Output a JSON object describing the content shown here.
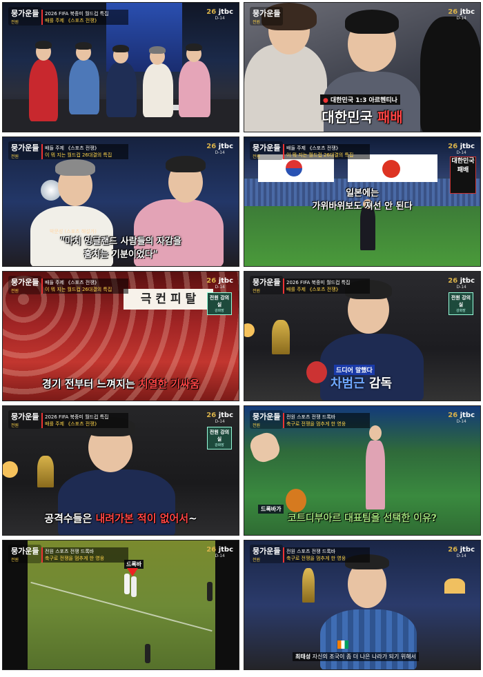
{
  "show": {
    "logo": "뭉가운들",
    "logo_sub": "전원",
    "channel_prefix": "26",
    "channel": "jtbc",
    "dday": "D-14"
  },
  "frames": [
    {
      "id": "f1",
      "topic": "2026 FIFA 북중미 월드컵 특집",
      "topic2": "배를 주제 《스포츠 전쟁》"
    },
    {
      "id": "f2",
      "score": "대한민국 1:3 아르헨티나",
      "caption": "대한민국 패배",
      "caption_red": "패배"
    },
    {
      "id": "f3",
      "topic": "배들 주제 《스포츠 전쟁》",
      "topic2": "이 뭐 지는 월드컵 26대결의 특집",
      "name": "박문성 (스포츠 해설가)",
      "quote_line1": "\"마치 잉글랜드 사람들의 자감을",
      "quote_line2": "훔치는 기분이었다\""
    },
    {
      "id": "f4",
      "topic": "배들 주제 《스포츠 전쟁》",
      "topic2": "이 뭐 지는 월드컵 26대결의 특집",
      "side_card": "대한민국 패배",
      "caption_line1": "일본에는",
      "caption_line2": "가위바위보도 져선 안 된다"
    },
    {
      "id": "f5",
      "topic": "배들 주제 《스포츠 전쟁》",
      "topic2": "이 뭐 지는 월드컵 26대결의 특집",
      "banner": "극 컨 피 탈",
      "badge": "전원 강의실",
      "badge_sub": "강화장",
      "caption_pre": "경기 전부터 느껴지는 ",
      "caption_red": "치열한 기싸움"
    },
    {
      "id": "f6",
      "topic": "2026 FIFA 북중미 월드컵 특집",
      "topic2": "배를 주제 《스포츠 전쟁》",
      "badge": "전원 강의실",
      "badge_sub": "강화장",
      "pre": "드디어 말했다",
      "caption_pre": "",
      "caption_red": "차범근",
      "caption_post": " 감독"
    },
    {
      "id": "f7",
      "topic": "2026 FIFA 북중미 월드컵 특집",
      "topic2": "배를 주제 《스포츠 전쟁》",
      "badge": "전원 강의실",
      "badge_sub": "강화장",
      "caption_pre": "공격수들은 ",
      "caption_red": "내려가본 적이 없어서",
      "caption_post": "~"
    },
    {
      "id": "f8",
      "topic": "전원 스포츠 전쟁 드록바",
      "topic2": "축구로 전쟁을 멈추게 한 영웅",
      "tag": "드록바가",
      "caption": "코트디부아르 대표팀을 선택한 이유?"
    },
    {
      "id": "f9",
      "topic": "전원 스포츠 전쟁 드록바",
      "topic2": "축구로 전쟁을 멈추게 한 영웅",
      "marker": "드록바"
    },
    {
      "id": "f10",
      "topic": "전원 스포츠 전쟁 드록바",
      "topic2": "축구로 전쟁을 멈추게 한 영웅",
      "name": "최태성",
      "subtitle": "자신의 조국이 좀 더 나은 나라가 되기 위해서"
    }
  ]
}
